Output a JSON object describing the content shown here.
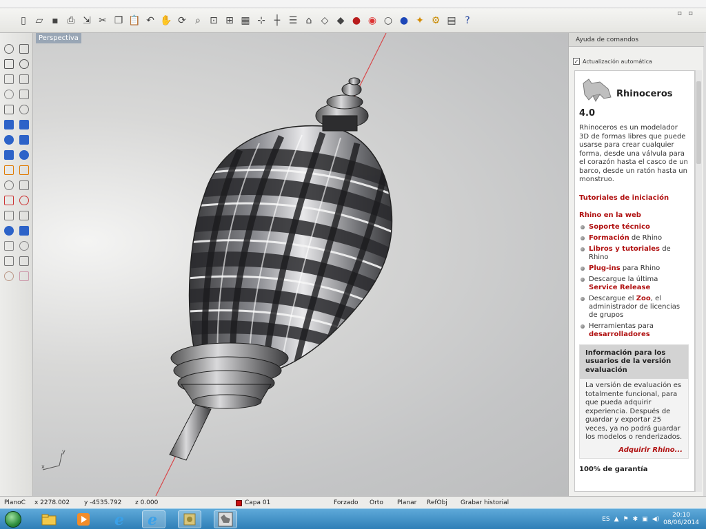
{
  "toolbar": {
    "icons": [
      "new-icon",
      "open-icon",
      "save-icon",
      "print-icon",
      "import-icon",
      "cut-icon",
      "copy-icon",
      "paste-icon",
      "undo-icon",
      "pan-icon",
      "rotate-icon",
      "zoom-icon",
      "zoom-window-icon",
      "zoom-extents-icon",
      "grid-icon",
      "snap-icon",
      "ortho-icon",
      "layers-icon",
      "properties-icon",
      "wireframe-icon",
      "shaded-icon",
      "rendered-icon",
      "color-wheel-icon",
      "sphere-icon",
      "blue-sphere-icon",
      "light-icon",
      "settings-gear-icon",
      "options-icon",
      "help-icon"
    ]
  },
  "viewport": {
    "label": "Perspectiva",
    "axis_x": "x",
    "axis_y": "y"
  },
  "right_panel": {
    "title": "Ayuda de comandos",
    "auto_update_label": "Actualización automática",
    "auto_update_checked": true,
    "product": "Rhinoceros",
    "version": "4.0",
    "description": "Rhinoceros es un modelador 3D de formas libres que puede usarse para crear cualquier forma, desde una válvula para el corazón hasta el casco de un barco, desde un ratón hasta un monstruo.",
    "tutorials_heading": "Tutoriales de iniciación",
    "web_heading": "Rhino en la web",
    "web_items": [
      {
        "bold": "Soporte técnico",
        "rest": ""
      },
      {
        "bold": "Formación",
        "rest": " de Rhino"
      },
      {
        "bold": "Libros y tutoriales",
        "rest": " de Rhino"
      },
      {
        "bold": "Plug-ins",
        "rest": " para Rhino"
      },
      {
        "pre": "Descargue la última ",
        "bold": "Service Release",
        "rest": ""
      },
      {
        "pre": "Descargue el ",
        "bold": "Zoo",
        "rest": ", el administrador de licencias de grupos"
      },
      {
        "pre": "Herramientas para ",
        "bold": "desarrolladores",
        "rest": ""
      }
    ],
    "info_heading": "Información para los usuarios de la versión evaluación",
    "info_body": "La versión de evaluación es totalmente funcional, para que pueda adquirir experiencia. Después de guardar y exportar 25 veces, ya no podrá guardar los modelos o renderizados.",
    "info_link": "Adquirir Rhino...",
    "guarantee": "100% de garantía"
  },
  "status_bar": {
    "plane": "PlanoC",
    "x": "x 2278.002",
    "y": "y -4535.792",
    "z": "z 0.000",
    "layer": "Capa 01",
    "layer_color": "#c81010",
    "toggles": [
      "Forzado",
      "Orto",
      "Planar",
      "RefObj",
      "Grabar historial"
    ]
  },
  "taskbar": {
    "apps": [
      "start-orb",
      "explorer-folder-icon",
      "media-player-icon",
      "ie-icon",
      "ie-icon-2",
      "rhino-tool-icon",
      "rhino-app-icon"
    ],
    "lang": "ES",
    "time": "20:10",
    "date": "08/06/2014"
  },
  "colors": {
    "link_red": "#b01010",
    "viewport_label_bg": "#99a6b5",
    "taskbar_blue": "#2f7fb7"
  }
}
